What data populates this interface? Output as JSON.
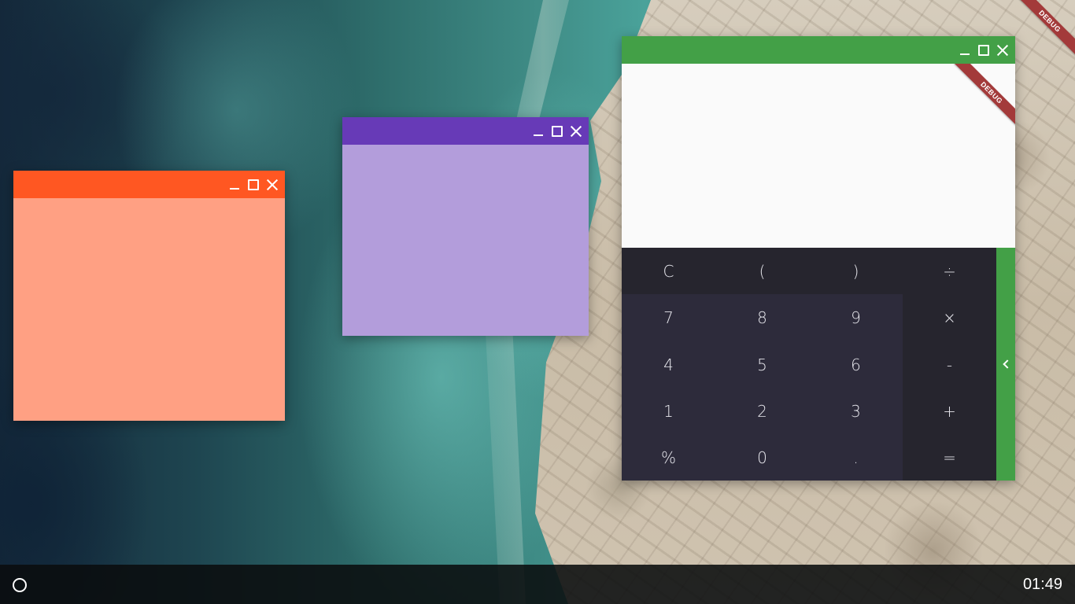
{
  "debug_banner": "DEBUG",
  "windows": {
    "orange": {
      "title_color": "#ff5722",
      "body_color": "#ffa083",
      "controls": [
        "minimize-icon",
        "maximize-icon",
        "close-icon"
      ]
    },
    "purple": {
      "title_color": "#673ab7",
      "body_color": "#b39ddb",
      "controls": [
        "minimize-icon",
        "maximize-icon",
        "close-icon"
      ]
    },
    "calculator": {
      "title_color": "#43a047",
      "debug_banner": "DEBUG",
      "display_value": "",
      "controls": [
        "minimize-icon",
        "maximize-icon",
        "close-icon"
      ],
      "keys": {
        "clear": "C",
        "open_paren": "(",
        "close_paren": ")",
        "divide": "÷",
        "seven": "7",
        "eight": "8",
        "nine": "9",
        "multiply": "×",
        "four": "4",
        "five": "5",
        "six": "6",
        "minus": "-",
        "one": "1",
        "two": "2",
        "three": "3",
        "plus": "+",
        "percent": "%",
        "zero": "0",
        "decimal": ".",
        "equals": "="
      },
      "side_panel_icon": "chevron-left-icon"
    }
  },
  "taskbar": {
    "launcher_icon": "circle-icon",
    "clock": "01:49"
  }
}
